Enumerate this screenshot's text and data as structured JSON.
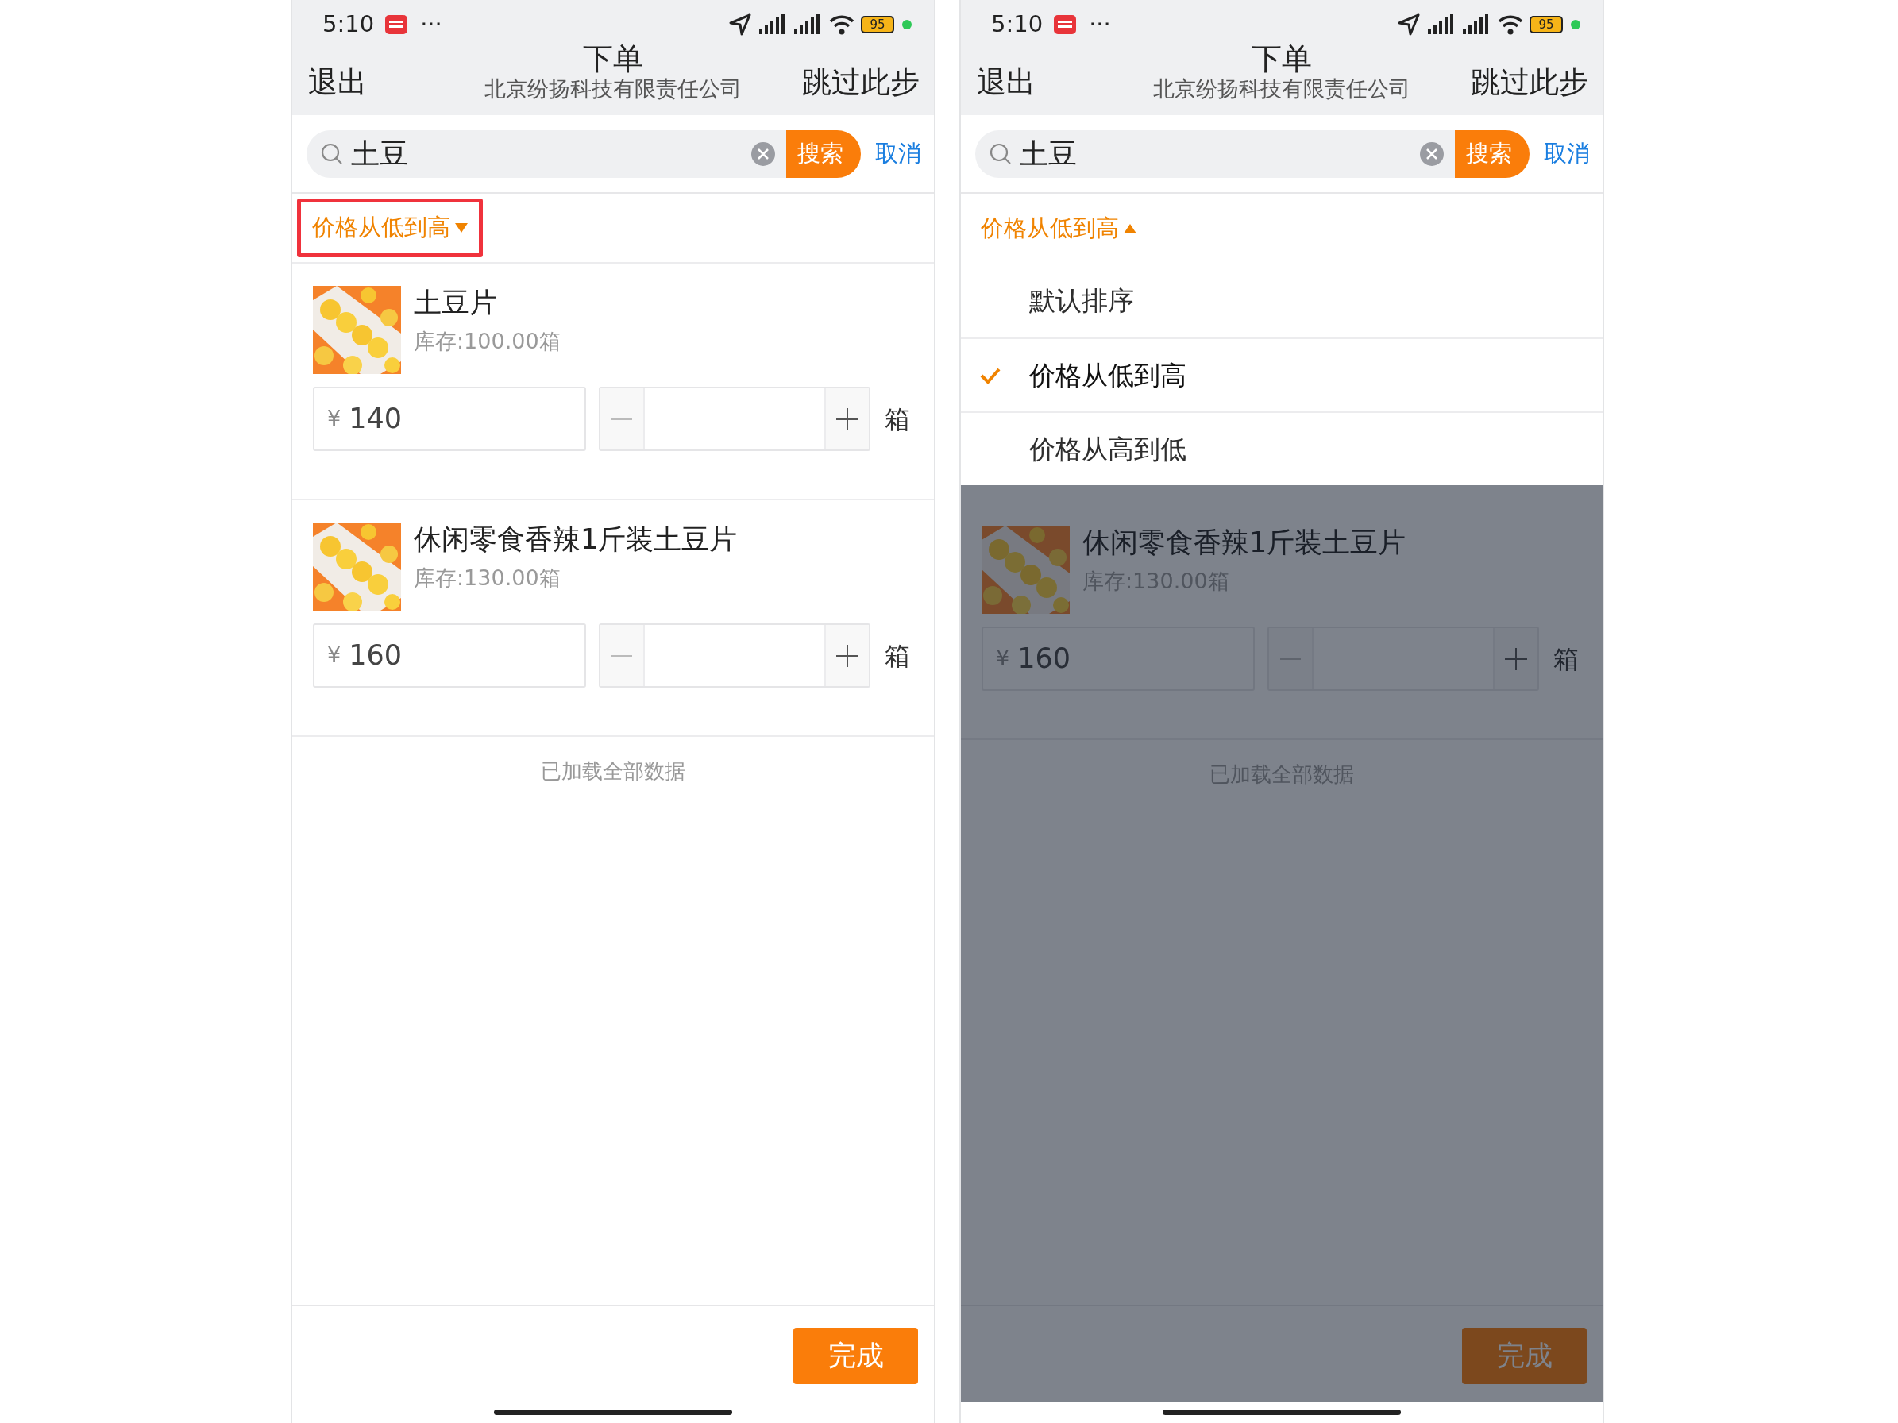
{
  "screens": [
    {
      "status_bar": {
        "time": "5:10",
        "more": "···",
        "battery": "95"
      },
      "nav": {
        "left": "退出",
        "title": "下单",
        "subtitle": "北京纷扬科技有限责任公司",
        "right": "跳过此步"
      },
      "search": {
        "value": "土豆",
        "button": "搜索",
        "cancel": "取消"
      },
      "sort": {
        "label": "价格从低到高",
        "expanded": false,
        "highlighted": true
      },
      "products": [
        {
          "name": "土豆片",
          "stock": "库存:100.00箱",
          "currency": "¥",
          "price": "140",
          "unit": "箱"
        },
        {
          "name": "休闲零食香辣1斤装土豆片",
          "stock": "库存:130.00箱",
          "currency": "¥",
          "price": "160",
          "unit": "箱"
        }
      ],
      "footer": "已加载全部数据",
      "done_button": "完成"
    },
    {
      "status_bar": {
        "time": "5:10",
        "more": "···",
        "battery": "95"
      },
      "nav": {
        "left": "退出",
        "title": "下单",
        "subtitle": "北京纷扬科技有限责任公司",
        "right": "跳过此步"
      },
      "search": {
        "value": "土豆",
        "button": "搜索",
        "cancel": "取消"
      },
      "sort": {
        "label": "价格从低到高",
        "expanded": true,
        "highlighted": false,
        "options": [
          {
            "label": "默认排序",
            "selected": false
          },
          {
            "label": "价格从低到高",
            "selected": true
          },
          {
            "label": "价格从高到低",
            "selected": false
          }
        ]
      },
      "products": [
        {
          "name": "休闲零食香辣1斤装土豆片",
          "stock": "库存:130.00箱",
          "currency": "¥",
          "price": "160",
          "unit": "箱"
        }
      ],
      "footer": "已加载全部数据",
      "done_button": "完成"
    }
  ]
}
